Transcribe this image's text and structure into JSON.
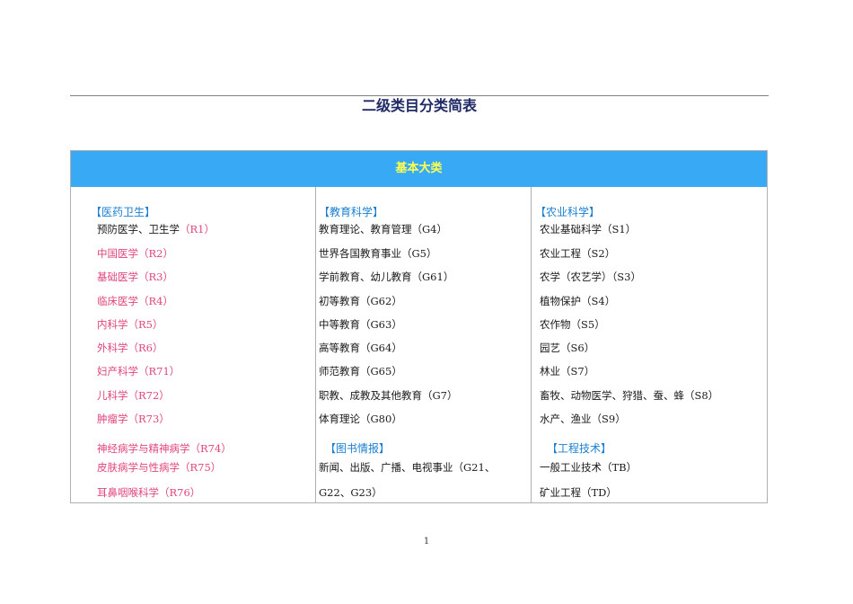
{
  "title": "二级类目分类简表",
  "table_header": "基本大类",
  "col1": {
    "heading": "【医药卫生】",
    "first_item_text": "预防医学、卫生学",
    "first_item_code": "（R1）",
    "items": [
      "中国医学（R2）",
      "基础医学（R3）",
      "临床医学（R4）",
      "内科学（R5）",
      "外科学（R6）",
      "妇产科学（R71）",
      "儿科学（R72）",
      "肿瘤学（R73）",
      "神经病学与精神病学（R74）",
      "皮肤病学与性病学（R75）",
      "耳鼻咽喉科学（R76）"
    ]
  },
  "col2": {
    "heading": "【教育科学】",
    "items": [
      "教育理论、教育管理（G4）",
      "世界各国教育事业（G5）",
      "学前教育、幼儿教育（G61）",
      "初等教育（G62）",
      "中等教育（G63）",
      "高等教育（G64）",
      "师范教育（G65）",
      "职教、成教及其他教育（G7）",
      "体育理论（G80）"
    ],
    "heading2": "【图书情报】",
    "items2": [
      "新闻、出版、广播、电视事业（G21、",
      "G22、G23）"
    ]
  },
  "col3": {
    "heading": "【农业科学】",
    "items": [
      "农业基础科学（S1）",
      "农业工程（S2）",
      "农学（农艺学）（S3）",
      "植物保护（S4）",
      "农作物（S5）",
      "园艺（S6）",
      "林业（S7）",
      "畜牧、动物医学、狩猎、蚕、蜂（S8）",
      "水产、渔业（S9）"
    ],
    "heading2": "【工程技术】",
    "items2": [
      "一般工业技术（TB）",
      "矿业工程（TD）"
    ]
  },
  "page_number": "1"
}
